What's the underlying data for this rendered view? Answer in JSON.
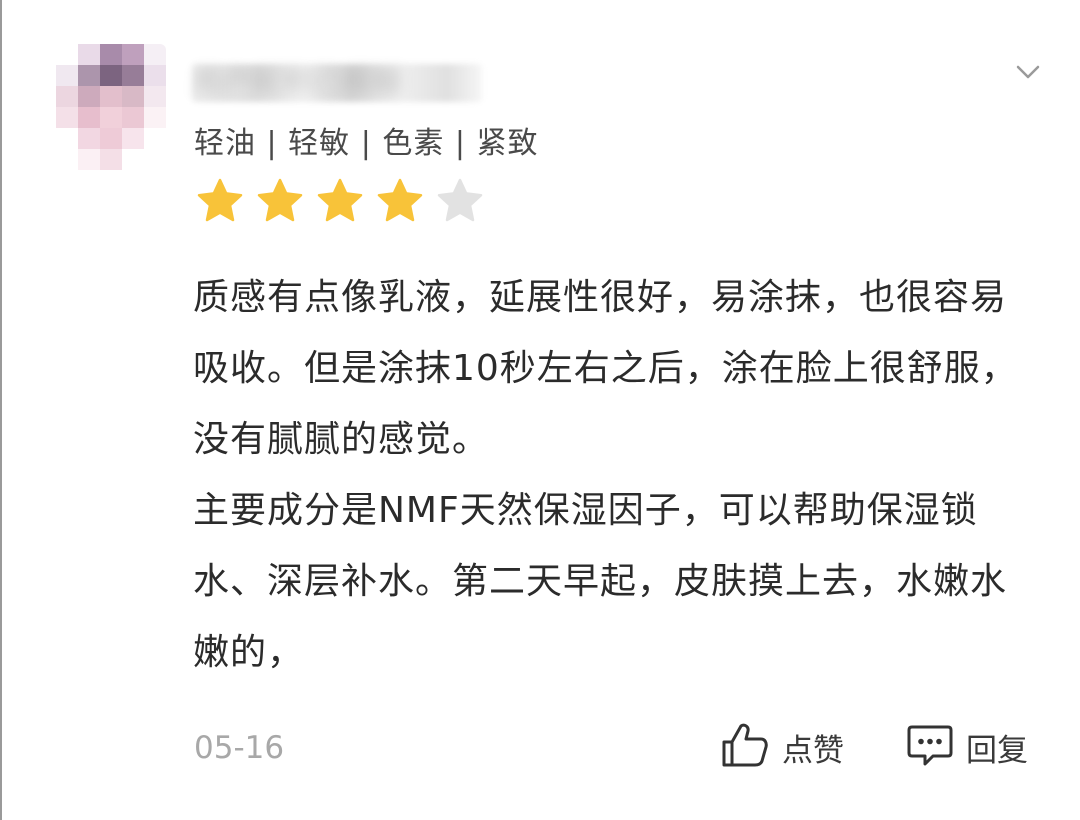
{
  "user": {
    "name_hidden": "用户昵称已模糊",
    "tags": "轻油 | 轻敏 | 色素 | 紧致"
  },
  "rating": {
    "value": 4,
    "max": 5,
    "filled_color": "#F8C339",
    "empty_color": "#E2E2E2"
  },
  "review": {
    "paragraph1": "质感有点像乳液，延展性很好，易涂抹，也很容易吸收。但是涂抹10秒左右之后，涂在脸上很舒服，没有腻腻的感觉。",
    "paragraph2": "主要成分是NMF天然保湿因子，可以帮助保湿锁水、深层补水。第二天早起，皮肤摸上去，水嫩水嫩的，"
  },
  "footer": {
    "date": "05-16",
    "like_label": "点赞",
    "reply_label": "回复"
  },
  "icons": {
    "expand": "chevron-down-icon",
    "like": "thumbs-up-icon",
    "reply": "comment-icon"
  }
}
